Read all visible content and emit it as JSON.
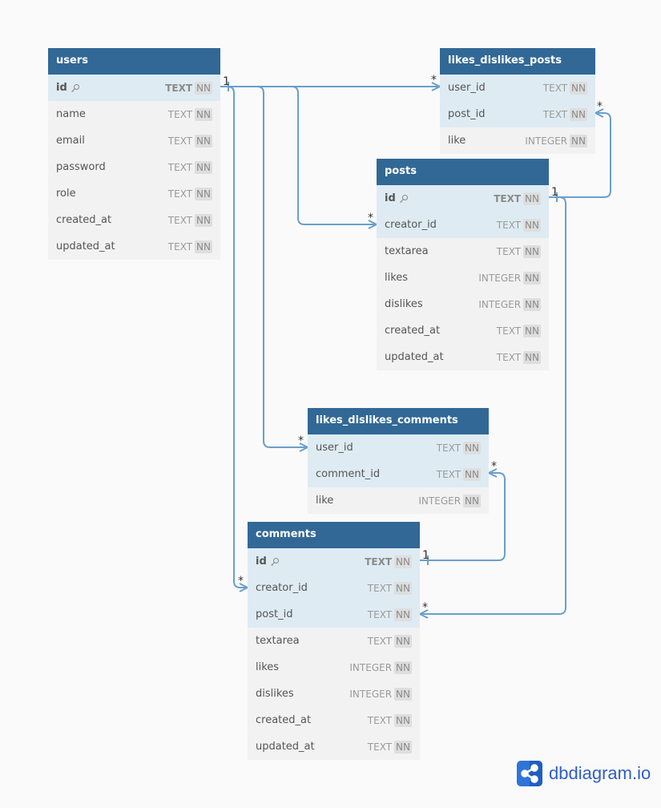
{
  "brand": {
    "name": "dbdiagram.io",
    "icon": "share-nodes-icon",
    "color": "#2f74d8"
  },
  "colors": {
    "header": "#316896",
    "relation_line": "#6a9fcb",
    "highlight_row": "#deebf3"
  },
  "tables": {
    "users": {
      "name": "users",
      "fields": [
        {
          "name": "id",
          "type": "TEXT",
          "nn": "NN",
          "pk": true
        },
        {
          "name": "name",
          "type": "TEXT",
          "nn": "NN"
        },
        {
          "name": "email",
          "type": "TEXT",
          "nn": "NN"
        },
        {
          "name": "password",
          "type": "TEXT",
          "nn": "NN"
        },
        {
          "name": "role",
          "type": "TEXT",
          "nn": "NN"
        },
        {
          "name": "created_at",
          "type": "TEXT",
          "nn": "NN"
        },
        {
          "name": "updated_at",
          "type": "TEXT",
          "nn": "NN"
        }
      ]
    },
    "likes_dislikes_posts": {
      "name": "likes_dislikes_posts",
      "fields": [
        {
          "name": "user_id",
          "type": "TEXT",
          "nn": "NN"
        },
        {
          "name": "post_id",
          "type": "TEXT",
          "nn": "NN"
        },
        {
          "name": "like",
          "type": "INTEGER",
          "nn": "NN"
        }
      ]
    },
    "posts": {
      "name": "posts",
      "fields": [
        {
          "name": "id",
          "type": "TEXT",
          "nn": "NN",
          "pk": true
        },
        {
          "name": "creator_id",
          "type": "TEXT",
          "nn": "NN"
        },
        {
          "name": "textarea",
          "type": "TEXT",
          "nn": "NN"
        },
        {
          "name": "likes",
          "type": "INTEGER",
          "nn": "NN"
        },
        {
          "name": "dislikes",
          "type": "INTEGER",
          "nn": "NN"
        },
        {
          "name": "created_at",
          "type": "TEXT",
          "nn": "NN"
        },
        {
          "name": "updated_at",
          "type": "TEXT",
          "nn": "NN"
        }
      ]
    },
    "likes_dislikes_comments": {
      "name": "likes_dislikes_comments",
      "fields": [
        {
          "name": "user_id",
          "type": "TEXT",
          "nn": "NN"
        },
        {
          "name": "comment_id",
          "type": "TEXT",
          "nn": "NN"
        },
        {
          "name": "like",
          "type": "INTEGER",
          "nn": "NN"
        }
      ]
    },
    "comments": {
      "name": "comments",
      "fields": [
        {
          "name": "id",
          "type": "TEXT",
          "nn": "NN",
          "pk": true
        },
        {
          "name": "creator_id",
          "type": "TEXT",
          "nn": "NN"
        },
        {
          "name": "post_id",
          "type": "TEXT",
          "nn": "NN"
        },
        {
          "name": "textarea",
          "type": "TEXT",
          "nn": "NN"
        },
        {
          "name": "likes",
          "type": "INTEGER",
          "nn": "NN"
        },
        {
          "name": "dislikes",
          "type": "INTEGER",
          "nn": "NN"
        },
        {
          "name": "created_at",
          "type": "TEXT",
          "nn": "NN"
        },
        {
          "name": "updated_at",
          "type": "TEXT",
          "nn": "NN"
        }
      ]
    }
  },
  "relations": [
    {
      "from": "users.id",
      "to": "likes_dislikes_posts.user_id",
      "from_card": "1",
      "to_card": "*"
    },
    {
      "from": "users.id",
      "to": "posts.creator_id",
      "from_card": "1",
      "to_card": "*"
    },
    {
      "from": "users.id",
      "to": "likes_dislikes_comments.user_id",
      "from_card": "1",
      "to_card": "*"
    },
    {
      "from": "users.id",
      "to": "comments.creator_id",
      "from_card": "1",
      "to_card": "*"
    },
    {
      "from": "posts.id",
      "to": "likes_dislikes_posts.post_id",
      "from_card": "1",
      "to_card": "*"
    },
    {
      "from": "posts.id",
      "to": "comments.post_id",
      "from_card": "1",
      "to_card": "*"
    },
    {
      "from": "comments.id",
      "to": "likes_dislikes_comments.comment_id",
      "from_card": "1",
      "to_card": "*"
    }
  ]
}
